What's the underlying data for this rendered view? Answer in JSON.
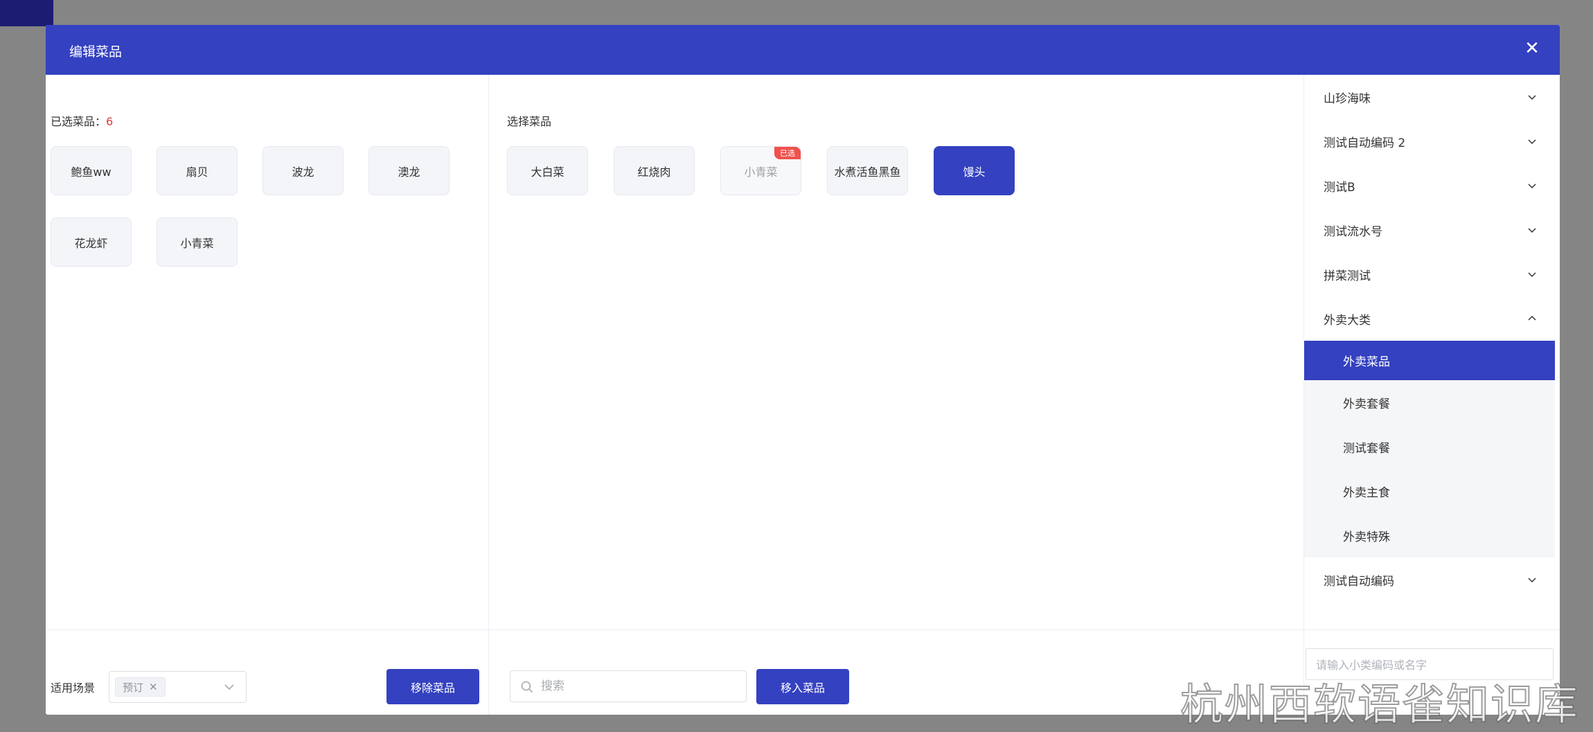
{
  "modal": {
    "title": "编辑菜品",
    "close_icon": "close-icon"
  },
  "selected_panel": {
    "label": "已选菜品：",
    "count": "6",
    "dishes": [
      "鲍鱼ww",
      "扇贝",
      "波龙",
      "澳龙",
      "花龙虾",
      "小青菜"
    ]
  },
  "choose_panel": {
    "label": "选择菜品",
    "dishes": [
      {
        "name": "大白菜",
        "state": "normal",
        "badge": ""
      },
      {
        "name": "红烧肉",
        "state": "normal",
        "badge": ""
      },
      {
        "name": "小青菜",
        "state": "disabled",
        "badge": "已选"
      },
      {
        "name": "水煮活鱼黑鱼",
        "state": "normal",
        "badge": ""
      },
      {
        "name": "馒头",
        "state": "selected",
        "badge": ""
      }
    ]
  },
  "footer": {
    "scene_label": "适用场景",
    "scene_tag": "预订",
    "remove_button": "移除菜品",
    "search_placeholder": "搜索",
    "move_in_button": "移入菜品"
  },
  "categories": {
    "items_top": [
      {
        "label": "山珍海味",
        "expanded": false
      },
      {
        "label": "测试自动编码 2",
        "expanded": false
      },
      {
        "label": "测试B",
        "expanded": false
      },
      {
        "label": "测试流水号",
        "expanded": false
      },
      {
        "label": "拼菜测试",
        "expanded": false
      },
      {
        "label": "外卖大类",
        "expanded": true
      }
    ],
    "sub_items": [
      {
        "label": "外卖菜品",
        "active": true
      },
      {
        "label": "外卖套餐",
        "active": false
      },
      {
        "label": "测试套餐",
        "active": false
      },
      {
        "label": "外卖主食",
        "active": false
      },
      {
        "label": "外卖特殊",
        "active": false
      }
    ],
    "items_bottom": [
      {
        "label": "测试自动编码",
        "expanded": false
      }
    ],
    "search_placeholder": "请输入小类编码或名字"
  },
  "watermark": "杭州西软语雀知识库",
  "colors": {
    "primary": "#3441c0",
    "badge": "#f0524d",
    "count": "#e53935"
  }
}
